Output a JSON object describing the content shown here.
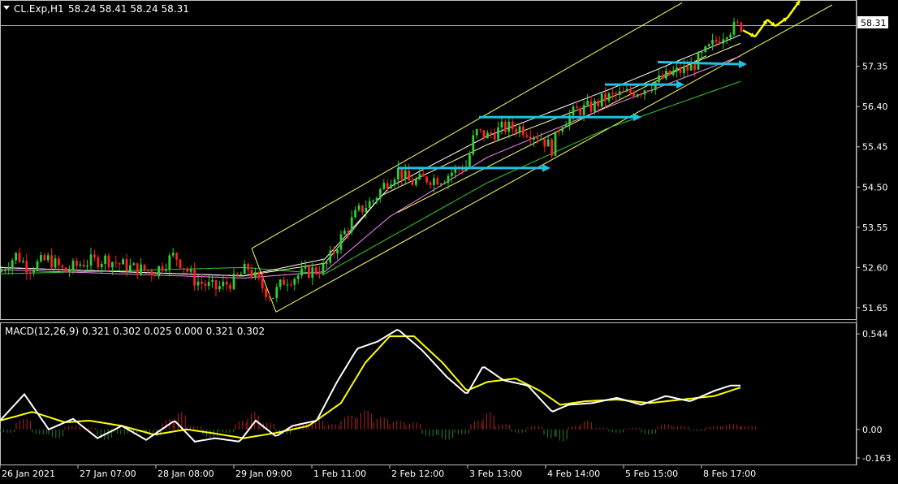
{
  "header": {
    "symbol_label": "CL.Exp,H1",
    "ohlc_text": "58.24 58.41 58.24 58.31",
    "last_price_badge": "58.31"
  },
  "chart_data": [
    {
      "type": "candlestick",
      "title": "CL.Exp,H1",
      "ylim": [
        51.4,
        58.8
      ],
      "ticks_y": [
        "57.35",
        "56.40",
        "55.45",
        "54.50",
        "53.55",
        "52.60",
        "51.65"
      ],
      "last_price": 58.31,
      "candles_note": "hourly candles, rising trend inside yellow channel",
      "path_points": [
        [
          0,
          52.5
        ],
        [
          20,
          52.9
        ],
        [
          35,
          52.6
        ],
        [
          60,
          52.8
        ],
        [
          80,
          52.5
        ],
        [
          100,
          52.7
        ],
        [
          130,
          52.8
        ],
        [
          160,
          52.6
        ],
        [
          190,
          52.5
        ],
        [
          215,
          52.9
        ],
        [
          240,
          52.3
        ],
        [
          265,
          52.1
        ],
        [
          290,
          52.3
        ],
        [
          305,
          52.6
        ],
        [
          320,
          52.2
        ],
        [
          335,
          51.9
        ],
        [
          350,
          52.3
        ],
        [
          380,
          52.5
        ],
        [
          400,
          52.6
        ],
        [
          420,
          53.3
        ],
        [
          440,
          53.9
        ],
        [
          460,
          54.2
        ],
        [
          475,
          54.6
        ],
        [
          490,
          54.9
        ],
        [
          505,
          54.6
        ],
        [
          525,
          54.7
        ],
        [
          545,
          54.7
        ],
        [
          560,
          54.9
        ],
        [
          575,
          55.0
        ],
        [
          585,
          55.8
        ],
        [
          600,
          55.7
        ],
        [
          620,
          55.9
        ],
        [
          640,
          55.9
        ],
        [
          665,
          55.7
        ],
        [
          680,
          55.4
        ],
        [
          690,
          56.0
        ],
        [
          710,
          56.3
        ],
        [
          730,
          56.4
        ],
        [
          745,
          56.6
        ],
        [
          770,
          56.7
        ],
        [
          790,
          56.8
        ],
        [
          810,
          57.0
        ],
        [
          830,
          57.2
        ],
        [
          850,
          57.3
        ],
        [
          865,
          57.6
        ],
        [
          880,
          57.9
        ],
        [
          895,
          58.2
        ],
        [
          910,
          58.3
        ]
      ],
      "channel": {
        "upper": [
          [
            310,
            53.05
          ],
          [
            840,
            58.85
          ]
        ],
        "lower": [
          [
            340,
            51.55
          ],
          [
            1025,
            58.8
          ]
        ],
        "mid": [
          [
            490,
            53.9
          ],
          [
            870,
            57.6
          ]
        ]
      },
      "level_arrows": [
        {
          "from": [
            490,
            54.95
          ],
          "to": [
            678,
            54.95
          ]
        },
        {
          "from": [
            590,
            56.15
          ],
          "to": [
            790,
            56.15
          ]
        },
        {
          "from": [
            745,
            56.92
          ],
          "to": [
            843,
            56.92
          ]
        },
        {
          "from": [
            810,
            57.45
          ],
          "to": [
            920,
            57.4
          ]
        }
      ],
      "projection_zigzag": [
        [
          915,
          58.2
        ],
        [
          930,
          58.05
        ],
        [
          945,
          58.45
        ],
        [
          955,
          58.3
        ],
        [
          970,
          58.5
        ],
        [
          985,
          58.9
        ]
      ],
      "moving_averages": [
        {
          "name": "",
          "color": "#32cd32",
          "points": [
            [
              0,
              52.45
            ],
            [
              300,
              52.6
            ],
            [
              400,
              52.45
            ],
            [
              600,
              54.6
            ],
            [
              750,
              55.9
            ],
            [
              913,
              57.0
            ]
          ]
        },
        {
          "name": "",
          "color": "#ff88ff",
          "points": [
            [
              0,
              52.55
            ],
            [
              300,
              52.35
            ],
            [
              400,
              52.5
            ],
            [
              480,
              53.8
            ],
            [
              600,
              55.2
            ],
            [
              750,
              56.4
            ],
            [
              913,
              57.6
            ]
          ]
        },
        {
          "name": "",
          "color": "#ffffaa",
          "points": [
            [
              0,
              52.6
            ],
            [
              300,
              52.4
            ],
            [
              400,
              52.7
            ],
            [
              470,
              54.3
            ],
            [
              600,
              55.5
            ],
            [
              750,
              56.6
            ],
            [
              913,
              57.9
            ]
          ]
        },
        {
          "name": "",
          "color": "#ffffff",
          "points": [
            [
              0,
              52.6
            ],
            [
              300,
              52.4
            ],
            [
              400,
              52.8
            ],
            [
              480,
              54.5
            ],
            [
              600,
              55.7
            ],
            [
              750,
              56.8
            ],
            [
              913,
              58.1
            ]
          ]
        }
      ]
    },
    {
      "type": "macd",
      "label": "MACD(12,26,9) 0.321 0.302 0.025 0.000 0.321 0.302",
      "ylim": [
        -0.2,
        0.6
      ],
      "ticks_y": [
        "0.544",
        "0.00",
        "-0.163"
      ],
      "macd_line": [
        [
          0,
          0.05
        ],
        [
          30,
          0.2
        ],
        [
          60,
          0.0
        ],
        [
          90,
          0.06
        ],
        [
          120,
          -0.05
        ],
        [
          150,
          0.02
        ],
        [
          180,
          -0.06
        ],
        [
          215,
          0.05
        ],
        [
          240,
          -0.07
        ],
        [
          265,
          -0.05
        ],
        [
          295,
          -0.07
        ],
        [
          315,
          0.05
        ],
        [
          340,
          -0.04
        ],
        [
          360,
          0.02
        ],
        [
          390,
          0.05
        ],
        [
          415,
          0.27
        ],
        [
          440,
          0.46
        ],
        [
          465,
          0.5
        ],
        [
          490,
          0.57
        ],
        [
          520,
          0.45
        ],
        [
          550,
          0.3
        ],
        [
          575,
          0.2
        ],
        [
          595,
          0.36
        ],
        [
          620,
          0.28
        ],
        [
          650,
          0.25
        ],
        [
          680,
          0.1
        ],
        [
          700,
          0.14
        ],
        [
          730,
          0.15
        ],
        [
          760,
          0.18
        ],
        [
          790,
          0.14
        ],
        [
          820,
          0.19
        ],
        [
          850,
          0.16
        ],
        [
          880,
          0.22
        ],
        [
          900,
          0.25
        ],
        [
          913,
          0.25
        ]
      ],
      "signal_line": [
        [
          0,
          0.05
        ],
        [
          40,
          0.1
        ],
        [
          80,
          0.04
        ],
        [
          110,
          0.05
        ],
        [
          150,
          0.02
        ],
        [
          190,
          -0.03
        ],
        [
          230,
          0.0
        ],
        [
          260,
          -0.02
        ],
        [
          300,
          -0.05
        ],
        [
          340,
          -0.02
        ],
        [
          380,
          0.02
        ],
        [
          420,
          0.15
        ],
        [
          450,
          0.38
        ],
        [
          480,
          0.53
        ],
        [
          510,
          0.53
        ],
        [
          545,
          0.38
        ],
        [
          575,
          0.22
        ],
        [
          600,
          0.27
        ],
        [
          635,
          0.29
        ],
        [
          665,
          0.22
        ],
        [
          690,
          0.14
        ],
        [
          720,
          0.16
        ],
        [
          760,
          0.17
        ],
        [
          800,
          0.15
        ],
        [
          840,
          0.17
        ],
        [
          880,
          0.19
        ],
        [
          913,
          0.24
        ]
      ],
      "histogram": [
        [
          0,
          -0.02
        ],
        [
          20,
          0.06
        ],
        [
          40,
          -0.03
        ],
        [
          60,
          -0.05
        ],
        [
          80,
          0.02
        ],
        [
          100,
          0.01
        ],
        [
          120,
          -0.06
        ],
        [
          140,
          -0.03
        ],
        [
          160,
          -0.02
        ],
        [
          180,
          -0.04
        ],
        [
          200,
          0.06
        ],
        [
          215,
          0.1
        ],
        [
          230,
          0.02
        ],
        [
          250,
          -0.05
        ],
        [
          270,
          -0.02
        ],
        [
          290,
          0.05
        ],
        [
          305,
          0.1
        ],
        [
          320,
          0.04
        ],
        [
          340,
          -0.03
        ],
        [
          360,
          0.04
        ],
        [
          380,
          0.06
        ],
        [
          400,
          0.03
        ],
        [
          420,
          0.08
        ],
        [
          440,
          0.11
        ],
        [
          460,
          0.07
        ],
        [
          480,
          0.05
        ],
        [
          500,
          0.04
        ],
        [
          520,
          -0.04
        ],
        [
          540,
          -0.06
        ],
        [
          560,
          -0.03
        ],
        [
          580,
          0.05
        ],
        [
          595,
          0.1
        ],
        [
          610,
          0.03
        ],
        [
          630,
          -0.02
        ],
        [
          650,
          0.02
        ],
        [
          670,
          -0.05
        ],
        [
          685,
          -0.07
        ],
        [
          700,
          0.02
        ],
        [
          715,
          0.05
        ],
        [
          730,
          0.01
        ],
        [
          750,
          -0.02
        ],
        [
          770,
          0.01
        ],
        [
          790,
          -0.03
        ],
        [
          810,
          0.03
        ],
        [
          830,
          0.02
        ],
        [
          850,
          -0.01
        ],
        [
          870,
          0.02
        ],
        [
          890,
          0.03
        ],
        [
          913,
          0.02
        ]
      ]
    }
  ],
  "time_axis": {
    "labels": [
      "26 Jan 2021",
      "27 Jan 07:00",
      "28 Jan 08:00",
      "29 Jan 09:00",
      "1 Feb 11:00",
      "2 Feb 12:00",
      "3 Feb 13:00",
      "4 Feb 14:00",
      "5 Feb 15:00",
      "8 Feb 17:00"
    ]
  },
  "colors": {
    "background": "#000000",
    "up_candle": "#32cd32",
    "down_candle": "#ff2020",
    "channel": "#ffff66",
    "arrow": "#20c0e0",
    "projection": "#ffff00",
    "macd_line": "#ffffff",
    "signal_line": "#ffff00",
    "hist_pos": "#b22222",
    "hist_neg": "#2e7d32",
    "axis_text": "#ffffff",
    "frame": "#c0c0c0"
  }
}
